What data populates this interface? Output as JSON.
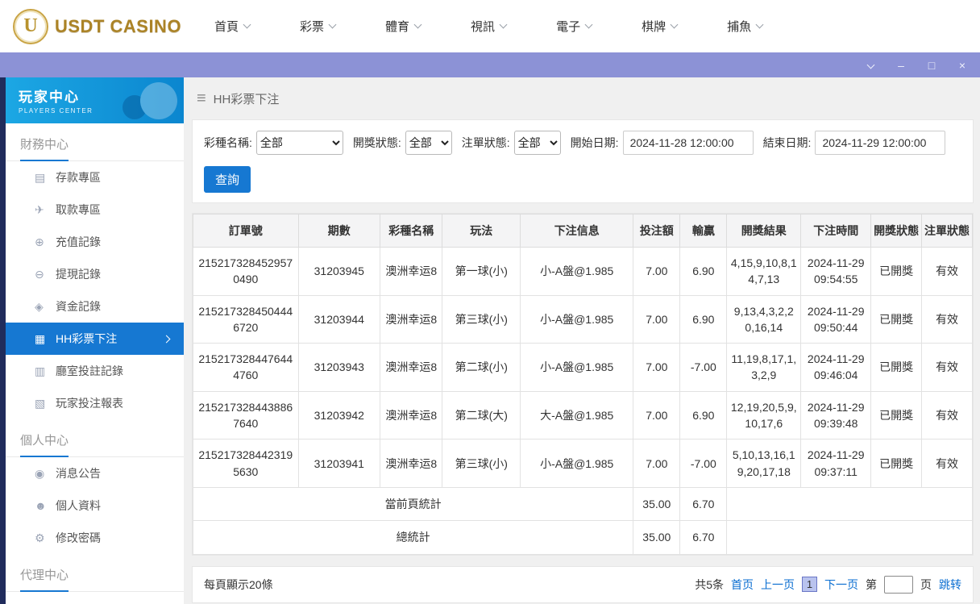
{
  "topbar": {
    "logo": {
      "badge": "U",
      "text": "USDT CASINO"
    },
    "nav": [
      {
        "key": "home",
        "label": "首頁"
      },
      {
        "key": "lottery",
        "label": "彩票"
      },
      {
        "key": "sports",
        "label": "體育"
      },
      {
        "key": "live-video",
        "label": "視訊"
      },
      {
        "key": "slots",
        "label": "電子"
      },
      {
        "key": "chess",
        "label": "棋牌"
      },
      {
        "key": "fishing",
        "label": "捕魚"
      }
    ]
  },
  "window_controls": {
    "minimize": "–",
    "maximize": "□",
    "close": "×"
  },
  "sidebar": {
    "header": {
      "title": "玩家中心",
      "subtitle": "PLAYERS CENTER"
    },
    "sections": [
      {
        "key": "finance",
        "title": "財務中心",
        "items": [
          {
            "key": "deposit",
            "glyph": "▤",
            "label": "存款專區"
          },
          {
            "key": "withdraw",
            "glyph": "✈",
            "label": "取款專區"
          },
          {
            "key": "recharge-record",
            "glyph": "⊕",
            "label": "充值記錄"
          },
          {
            "key": "withdrawal-record",
            "glyph": "⊖",
            "label": "提現記錄"
          },
          {
            "key": "funds-record",
            "glyph": "◈",
            "label": "資金記錄"
          },
          {
            "key": "hh-lottery-bets",
            "glyph": "▦",
            "label": "HH彩票下注",
            "active": true
          },
          {
            "key": "hall-bet-record",
            "glyph": "▥",
            "label": "廳室投註記錄"
          },
          {
            "key": "player-bet-report",
            "glyph": "▧",
            "label": "玩家投注報表"
          }
        ]
      },
      {
        "key": "personal",
        "title": "個人中心",
        "items": [
          {
            "key": "announcements",
            "glyph": "◉",
            "label": "消息公告"
          },
          {
            "key": "profile",
            "glyph": "☻",
            "label": "個人資料"
          },
          {
            "key": "change-password",
            "glyph": "⚙",
            "label": "修改密碼"
          }
        ]
      },
      {
        "key": "agent",
        "title": "代理中心",
        "items": []
      }
    ]
  },
  "page": {
    "menu_glyph": "≡",
    "title": "HH彩票下注"
  },
  "filters": {
    "lottery_name": {
      "label": "彩種名稱:",
      "value": "全部"
    },
    "draw_status": {
      "label": "開獎狀態:",
      "value": "全部"
    },
    "order_status": {
      "label": "注單狀態:",
      "value": "全部"
    },
    "start_date": {
      "label": "開始日期:",
      "value": "2024-11-28 12:00:00"
    },
    "end_date": {
      "label": "結束日期:",
      "value": "2024-11-29 12:00:00"
    },
    "search_label": "查詢"
  },
  "table": {
    "columns": [
      "訂單號",
      "期數",
      "彩種名稱",
      "玩法",
      "下注信息",
      "投注額",
      "輸贏",
      "開獎結果",
      "下注時間",
      "開獎狀態",
      "注單狀態"
    ],
    "column_keys": [
      "order-id",
      "period",
      "lottery-name",
      "play-type",
      "bet-info",
      "bet-amount",
      "win-loss",
      "draw-result",
      "bet-time",
      "draw-status",
      "order-status"
    ],
    "rows": [
      [
        "2152173284529570490",
        "31203945",
        "澳洲幸运8",
        "第一球(小)",
        "小-A盤@1.985",
        "7.00",
        "6.90",
        "4,15,9,10,8,14,7,13",
        "2024-11-29 09:54:55",
        "已開獎",
        "有效"
      ],
      [
        "2152173284504446720",
        "31203944",
        "澳洲幸运8",
        "第三球(小)",
        "小-A盤@1.985",
        "7.00",
        "6.90",
        "9,13,4,3,2,20,16,14",
        "2024-11-29 09:50:44",
        "已開獎",
        "有效"
      ],
      [
        "2152173284476444760",
        "31203943",
        "澳洲幸运8",
        "第二球(小)",
        "小-A盤@1.985",
        "7.00",
        "-7.00",
        "11,19,8,17,1,3,2,9",
        "2024-11-29 09:46:04",
        "已開獎",
        "有效"
      ],
      [
        "2152173284438867640",
        "31203942",
        "澳洲幸运8",
        "第二球(大)",
        "大-A盤@1.985",
        "7.00",
        "6.90",
        "12,19,20,5,9,10,17,6",
        "2024-11-29 09:39:48",
        "已開獎",
        "有效"
      ],
      [
        "2152173284423195630",
        "31203941",
        "澳洲幸运8",
        "第三球(小)",
        "小-A盤@1.985",
        "7.00",
        "-7.00",
        "5,10,13,16,19,20,17,18",
        "2024-11-29 09:37:11",
        "已開獎",
        "有效"
      ]
    ],
    "summary": [
      {
        "label": "當前頁統計",
        "bet": "35.00",
        "winloss": "6.70"
      },
      {
        "label": "總統計",
        "bet": "35.00",
        "winloss": "6.70"
      }
    ]
  },
  "footer": {
    "page_size_text": "每頁顯示20條",
    "total_text": "共5条",
    "first": "首页",
    "prev": "上一页",
    "current": "1",
    "next": "下一页",
    "jump_prefix": "第",
    "jump_suffix": "页",
    "jump_action": "跳转"
  },
  "colors": {
    "accent_blue": "#1678d2",
    "titlebar_purple": "#8c92d6",
    "logo_gold": "#ab8326",
    "link_blue": "#0a6ed1",
    "sidebar_header_blue": "#0b86cf"
  }
}
